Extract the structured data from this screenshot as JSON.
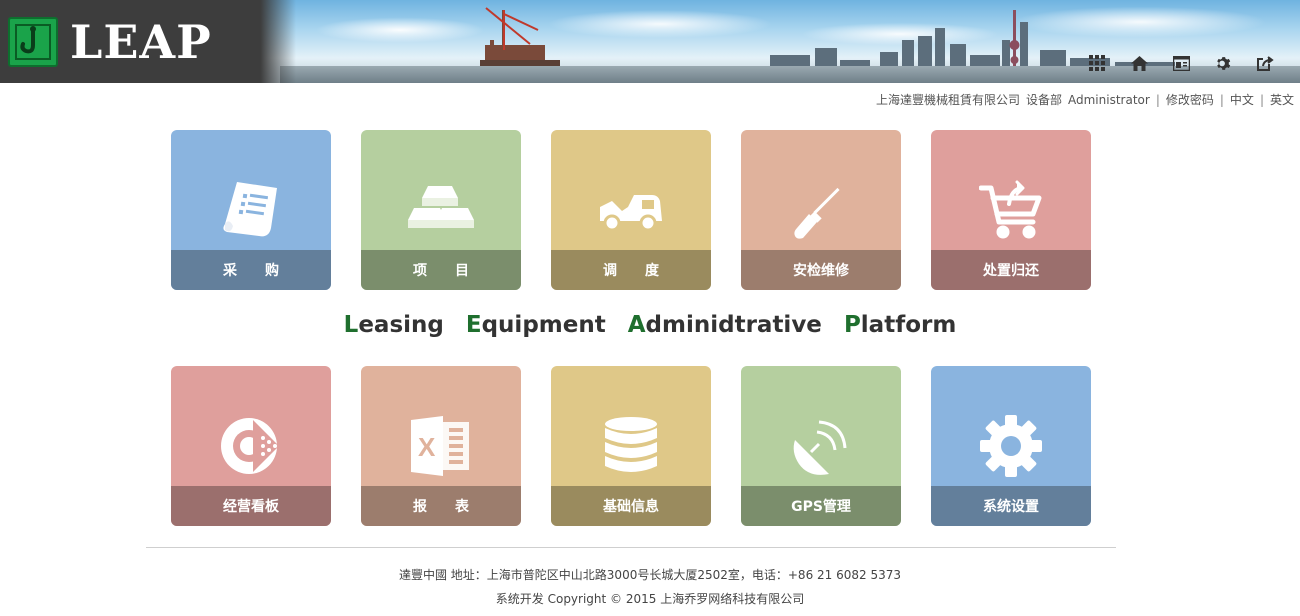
{
  "header": {
    "logo_text": "LEAP",
    "icons": [
      "apps-grid-icon",
      "home-icon",
      "dashboard-icon",
      "gear-icon",
      "logout-icon"
    ]
  },
  "userbar": {
    "company": "上海達豐機械租賃有限公司",
    "department": "设备部",
    "user": "Administrator",
    "change_password": "修改密码",
    "lang_cn": "中文",
    "lang_en": "英文",
    "separator": "|"
  },
  "tiles_top": [
    {
      "label": "采　　购",
      "color": "blue",
      "icon": "purchase-document-icon"
    },
    {
      "label": "项　　目",
      "color": "green",
      "icon": "project-gold-bars-icon"
    },
    {
      "label": "调　　度",
      "color": "yellow",
      "icon": "dispatch-truck-icon"
    },
    {
      "label": "安检维修",
      "color": "peach",
      "icon": "repair-screwdriver-icon"
    },
    {
      "label": "处置归还",
      "color": "pink",
      "icon": "return-cart-icon"
    }
  ],
  "tagline": {
    "words": [
      {
        "cap": "L",
        "rest": "easing"
      },
      {
        "cap": "E",
        "rest": "quipment"
      },
      {
        "cap": "A",
        "rest": "dminidtrative"
      },
      {
        "cap": "P",
        "rest": "latform"
      }
    ]
  },
  "tiles_bottom": [
    {
      "label": "经营看板",
      "color": "pink",
      "icon": "dashboard-chart-icon"
    },
    {
      "label": "报　　表",
      "color": "peach",
      "icon": "excel-report-icon"
    },
    {
      "label": "基础信息",
      "color": "yellow",
      "icon": "database-icon"
    },
    {
      "label": "GPS管理",
      "color": "green",
      "icon": "satellite-dish-icon"
    },
    {
      "label": "系统设置",
      "color": "blue",
      "icon": "settings-gear-icon"
    }
  ],
  "footer": {
    "line1": "達豐中國 地址：上海市普陀区中山北路3000号长城大厦2502室，电话：+86 21 6082 5373",
    "line2": "系统开发 Copyright © 2015 上海乔罗网络科技有限公司"
  }
}
